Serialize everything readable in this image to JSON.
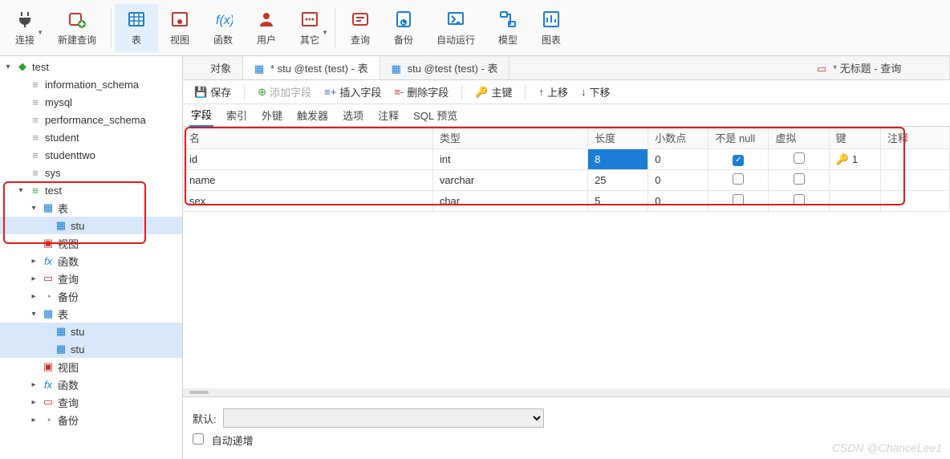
{
  "toolbar": [
    {
      "label": "连接",
      "icon": "plug",
      "dropdown": true
    },
    {
      "label": "新建查询",
      "icon": "query-new"
    },
    {
      "sep": true
    },
    {
      "label": "表",
      "icon": "table",
      "active": true
    },
    {
      "label": "视图",
      "icon": "view"
    },
    {
      "label": "函数",
      "icon": "fx"
    },
    {
      "label": "用户",
      "icon": "user"
    },
    {
      "label": "其它",
      "icon": "other",
      "dropdown": true
    },
    {
      "sep": true
    },
    {
      "label": "查询",
      "icon": "query"
    },
    {
      "label": "备份",
      "icon": "backup"
    },
    {
      "label": "自动运行",
      "icon": "automation"
    },
    {
      "label": "模型",
      "icon": "model"
    },
    {
      "label": "图表",
      "icon": "chart"
    }
  ],
  "tree": {
    "root": {
      "label": "test",
      "icon": "server-green",
      "expanded": true
    },
    "databases": [
      {
        "label": "information_schema",
        "icon": "db-gray"
      },
      {
        "label": "mysql",
        "icon": "db-gray"
      },
      {
        "label": "performance_schema",
        "icon": "db-gray"
      },
      {
        "label": "student",
        "icon": "db-gray"
      },
      {
        "label": "studenttwo",
        "icon": "db-gray"
      },
      {
        "label": "sys",
        "icon": "db-gray"
      },
      {
        "label": "test",
        "icon": "db-green",
        "expanded": true,
        "children": [
          {
            "label": "表",
            "icon": "tables",
            "expanded": true,
            "children": [
              {
                "label": "stu",
                "icon": "table-small",
                "selected": true
              }
            ]
          },
          {
            "label": "视图",
            "icon": "views"
          },
          {
            "label": "函数",
            "icon": "fx-small",
            "caret": true
          },
          {
            "label": "查询",
            "icon": "query-small",
            "caret": true
          },
          {
            "label": "备份",
            "icon": "backup-small",
            "caret": true
          }
        ]
      }
    ]
  },
  "doc_tabs": [
    {
      "label": "对象",
      "icon": "none"
    },
    {
      "label": "* stu @test (test) - 表",
      "icon": "table",
      "active": true
    },
    {
      "label": "stu @test (test) - 表",
      "icon": "table",
      "right": false
    },
    {
      "label": "* 无标题 - 查询",
      "icon": "query-red",
      "right": true
    }
  ],
  "sub_toolbar": {
    "save": "保存",
    "add_field": "添加字段",
    "insert_field": "插入字段",
    "delete_field": "删除字段",
    "primary_key": "主键",
    "move_up": "上移",
    "move_down": "下移"
  },
  "inner_tabs": [
    "字段",
    "索引",
    "外键",
    "触发器",
    "选项",
    "注释",
    "SQL 预览"
  ],
  "inner_tab_active": "字段",
  "grid": {
    "columns": [
      "名",
      "类型",
      "长度",
      "小数点",
      "不是 null",
      "虚拟",
      "键",
      "注释"
    ],
    "rows": [
      {
        "name": "id",
        "type": "int",
        "length": "8",
        "length_selected": true,
        "decimals": "0",
        "not_null": true,
        "virtual": false,
        "key": "1",
        "comment": ""
      },
      {
        "name": "name",
        "type": "varchar",
        "length": "25",
        "decimals": "0",
        "not_null": false,
        "virtual": false,
        "key": "",
        "comment": ""
      },
      {
        "name": "sex",
        "type": "char",
        "length": "5",
        "decimals": "0",
        "not_null": false,
        "virtual": false,
        "key": "",
        "comment": ""
      }
    ]
  },
  "bottom": {
    "default_label": "默认:",
    "auto_increment_label": "自动递增"
  },
  "watermark": "CSDN @ChanceLee1"
}
